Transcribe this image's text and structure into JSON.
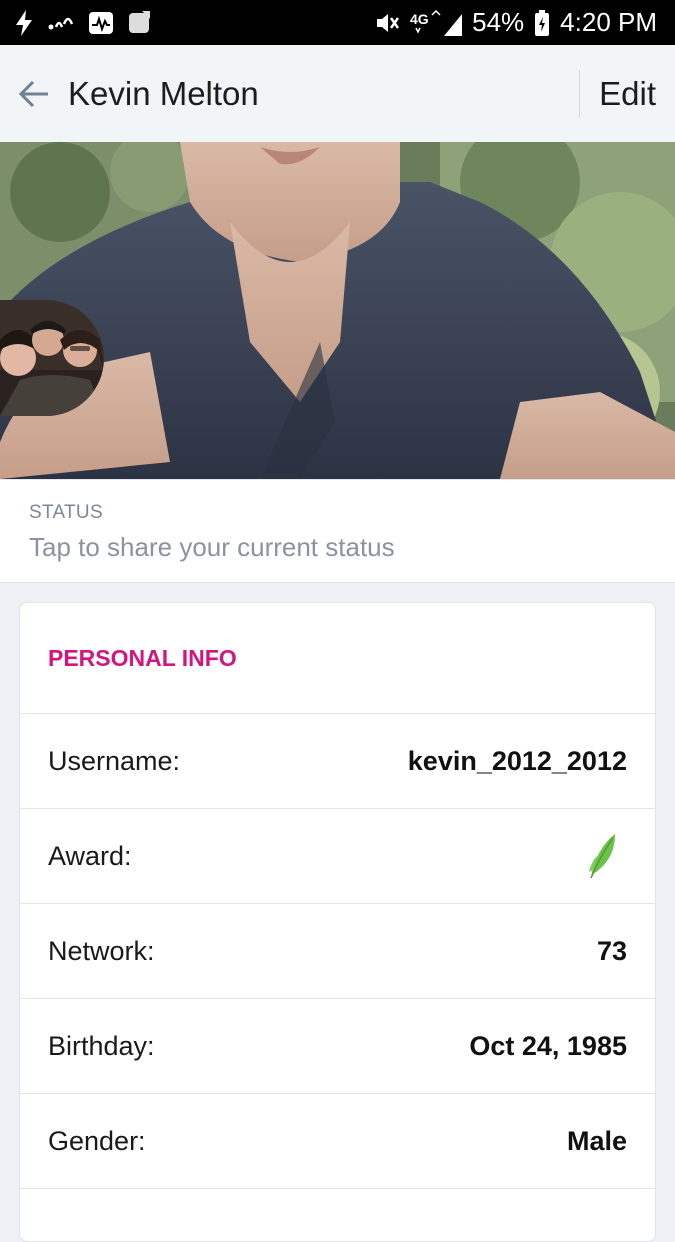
{
  "status_bar": {
    "battery": "54%",
    "time": "4:20 PM",
    "network_type": "4G"
  },
  "header": {
    "title": "Kevin Melton",
    "edit_label": "Edit"
  },
  "status": {
    "label": "STATUS",
    "placeholder": "Tap to share your current status"
  },
  "personal_info": {
    "title": "PERSONAL INFO",
    "rows": [
      {
        "label": "Username:",
        "value": "kevin_2012_2012"
      },
      {
        "label": "Award:",
        "value": ""
      },
      {
        "label": "Network:",
        "value": "73"
      },
      {
        "label": "Birthday:",
        "value": "Oct 24, 1985"
      },
      {
        "label": "Gender:",
        "value": "Male"
      }
    ]
  },
  "colors": {
    "accent": "#d4157e",
    "award_leaf": "#6cc24a"
  },
  "icons": {
    "back": "arrow-left-icon",
    "award": "leaf-icon"
  }
}
